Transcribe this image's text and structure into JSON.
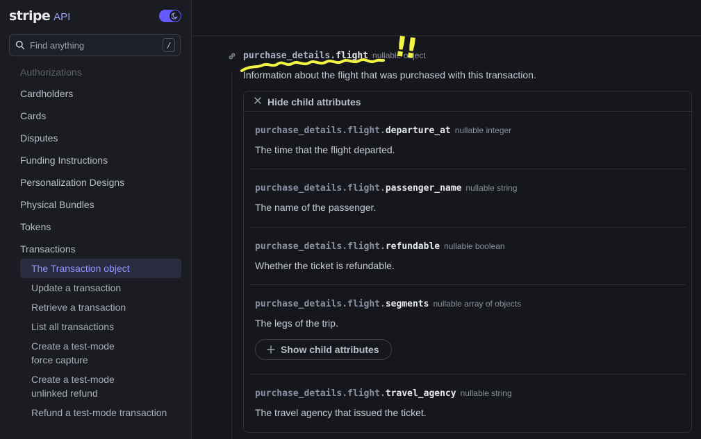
{
  "brand": {
    "logo": "stripe",
    "api_label": "API"
  },
  "search": {
    "placeholder": "Find anything",
    "shortcut": "/"
  },
  "sidebar": {
    "items": [
      {
        "label": "Authorizations"
      },
      {
        "label": "Cardholders"
      },
      {
        "label": "Cards"
      },
      {
        "label": "Disputes"
      },
      {
        "label": "Funding Instructions"
      },
      {
        "label": "Personalization Designs"
      },
      {
        "label": "Physical Bundles"
      },
      {
        "label": "Tokens"
      },
      {
        "label": "Transactions"
      }
    ],
    "sub_items": [
      {
        "label": "The Transaction object"
      },
      {
        "label": "Update a transaction"
      },
      {
        "label": "Retrieve a transaction"
      },
      {
        "label": "List all transactions"
      },
      {
        "label": "Create a test-mode force capture"
      },
      {
        "label": "Create a test-mode unlinked refund"
      },
      {
        "label": "Refund a test-mode transaction"
      }
    ]
  },
  "attribute": {
    "prefix": "purchase_details.",
    "name": "flight",
    "type": "nullable object",
    "description": "Information about the flight that was purchased with this transaction.",
    "hide_label": "Hide child attributes"
  },
  "children": [
    {
      "prefix": "purchase_details.flight.",
      "name": "departure_at",
      "type": "nullable integer",
      "description": "The time that the flight departed."
    },
    {
      "prefix": "purchase_details.flight.",
      "name": "passenger_name",
      "type": "nullable string",
      "description": "The name of the passenger."
    },
    {
      "prefix": "purchase_details.flight.",
      "name": "refundable",
      "type": "nullable boolean",
      "description": "Whether the ticket is refundable."
    },
    {
      "prefix": "purchase_details.flight.",
      "name": "segments",
      "type": "nullable array of objects",
      "description": "The legs of the trip.",
      "show_label": "Show child attributes"
    },
    {
      "prefix": "purchase_details.flight.",
      "name": "travel_agency",
      "type": "nullable string",
      "description": "The travel agency that issued the ticket."
    }
  ],
  "annotation": {
    "mark": "!!",
    "color": "#f2f542"
  },
  "colors": {
    "accent": "#635bff",
    "background": "#16171d",
    "sidebar": "#1b1c22",
    "active_text": "#8e96ff"
  }
}
